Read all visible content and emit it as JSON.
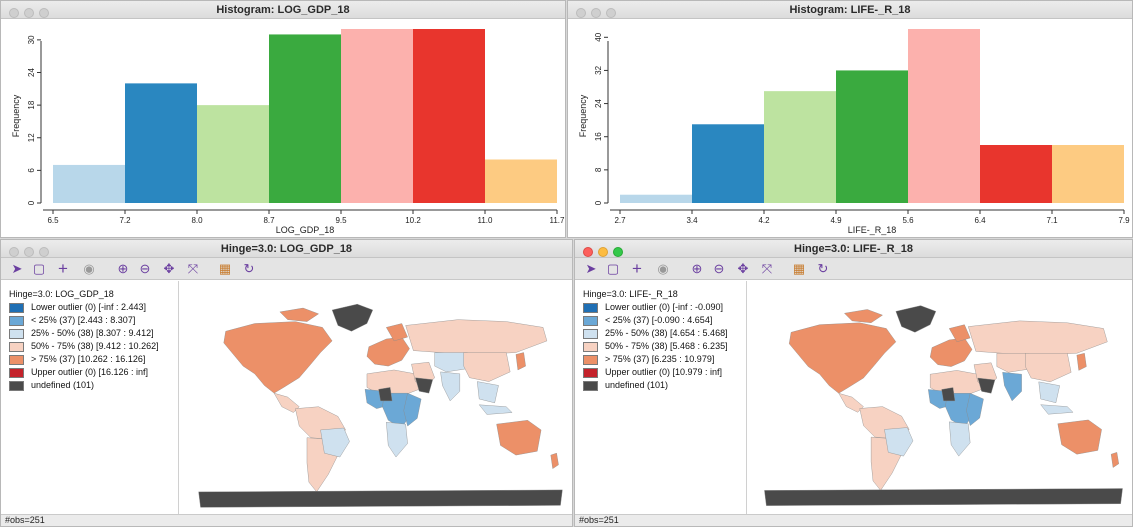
{
  "windows": {
    "hist_gdp": {
      "title": "Histogram: LOG_GDP_18"
    },
    "hist_life": {
      "title": "Histogram: LIFE-_R_18"
    },
    "map_gdp": {
      "title": "Hinge=3.0: LOG_GDP_18",
      "legend_title": "Hinge=3.0: LOG_GDP_18",
      "legend": [
        {
          "label": "Lower outlier (0)  [-inf : 2.443]",
          "color": "#1f6fb4"
        },
        {
          "label": "< 25% (37)  [2.443 : 8.307]",
          "color": "#6ba8d6"
        },
        {
          "label": "25% - 50% (38)  [8.307 : 9.412]",
          "color": "#cfe1ef"
        },
        {
          "label": "50% - 75% (38)  [9.412 : 10.262]",
          "color": "#f7d2c2"
        },
        {
          "label": "> 75% (37)  [10.262 : 16.126]",
          "color": "#ec9068"
        },
        {
          "label": "Upper outlier (0)  [16.126 : inf]",
          "color": "#c4222b"
        },
        {
          "label": "undefined (101)",
          "color": "#4a4a4a"
        }
      ],
      "status": "#obs=251"
    },
    "map_life": {
      "title": "Hinge=3.0: LIFE-_R_18",
      "legend_title": "Hinge=3.0: LIFE-_R_18",
      "legend": [
        {
          "label": "Lower outlier (0)  [-inf : -0.090]",
          "color": "#1f6fb4"
        },
        {
          "label": "< 25% (37)  [-0.090 : 4.654]",
          "color": "#6ba8d6"
        },
        {
          "label": "25% - 50% (38)  [4.654 : 5.468]",
          "color": "#cfe1ef"
        },
        {
          "label": "50% - 75% (38)  [5.468 : 6.235]",
          "color": "#f7d2c2"
        },
        {
          "label": "> 75% (37)  [6.235 : 10.979]",
          "color": "#ec9068"
        },
        {
          "label": "Upper outlier (0)  [10.979 : inf]",
          "color": "#c4222b"
        },
        {
          "label": "undefined (101)",
          "color": "#4a4a4a"
        }
      ],
      "status": "#obs=251"
    }
  },
  "toolbar_icons": [
    "select-arrow-icon",
    "select-rect-icon",
    "add-plus-icon",
    "layer-db-icon",
    "zoom-in-icon",
    "zoom-out-icon",
    "pan-icon",
    "full-extent-icon",
    "basemap-icon",
    "refresh-icon"
  ],
  "chart_data": [
    {
      "type": "bar",
      "xlabel": "LOG_GDP_18",
      "ylabel": "Frequency",
      "x_ticks": [
        "6.5",
        "7.2",
        "8.0",
        "8.7",
        "9.5",
        "10.2",
        "11.0",
        "11.7"
      ],
      "y_ticks": [
        "0",
        "6",
        "12",
        "18",
        "24",
        "30"
      ],
      "ylim": [
        0,
        32
      ],
      "values": [
        7,
        22,
        18,
        31,
        32,
        32,
        8
      ],
      "colors": [
        "#b8d7ea",
        "#2a87c0",
        "#bde3a0",
        "#3aaa3f",
        "#fcb1ad",
        "#e8352d",
        "#fdcb82"
      ]
    },
    {
      "type": "bar",
      "xlabel": "LIFE-_R_18",
      "ylabel": "Frequency",
      "x_ticks": [
        "2.7",
        "3.4",
        "4.2",
        "4.9",
        "5.6",
        "6.4",
        "7.1",
        "7.9"
      ],
      "y_ticks": [
        "0",
        "8",
        "16",
        "24",
        "32",
        "40"
      ],
      "ylim": [
        0,
        42
      ],
      "values": [
        2,
        19,
        27,
        32,
        42,
        14,
        14
      ],
      "colors": [
        "#b8d7ea",
        "#2a87c0",
        "#bde3a0",
        "#3aaa3f",
        "#fcb1ad",
        "#e8352d",
        "#fdcb82"
      ]
    }
  ]
}
